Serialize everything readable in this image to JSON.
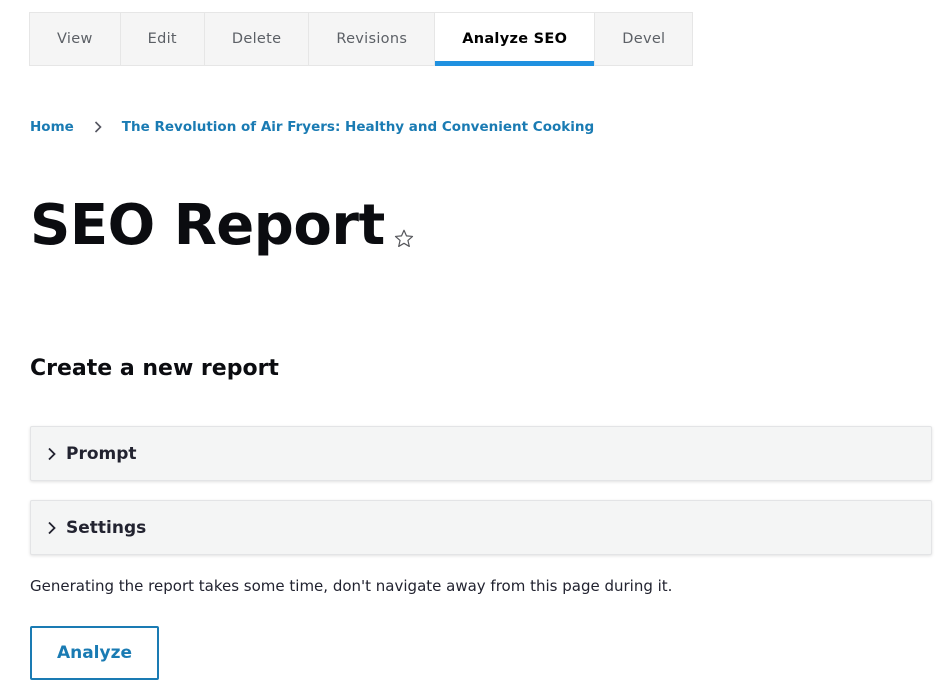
{
  "tabs": [
    {
      "label": "View",
      "active": false
    },
    {
      "label": "Edit",
      "active": false
    },
    {
      "label": "Delete",
      "active": false
    },
    {
      "label": "Revisions",
      "active": false
    },
    {
      "label": "Analyze SEO",
      "active": true
    },
    {
      "label": "Devel",
      "active": false
    }
  ],
  "breadcrumb": {
    "home": "Home",
    "current": "The Revolution of Air Fryers: Healthy and Convenient Cooking"
  },
  "page": {
    "title": "SEO Report",
    "favorite_icon": "star-outline-icon"
  },
  "form": {
    "heading": "Create a new report",
    "sections": [
      {
        "label": "Prompt",
        "icon": "chevron-right-icon",
        "expanded": false
      },
      {
        "label": "Settings",
        "icon": "chevron-right-icon",
        "expanded": false
      }
    ],
    "help_text": "Generating the report takes some time, don't navigate away from this page during it.",
    "submit_label": "Analyze"
  },
  "colors": {
    "accent": "#2091e0",
    "link": "#1a7bb3",
    "title": "#0b0c10"
  }
}
